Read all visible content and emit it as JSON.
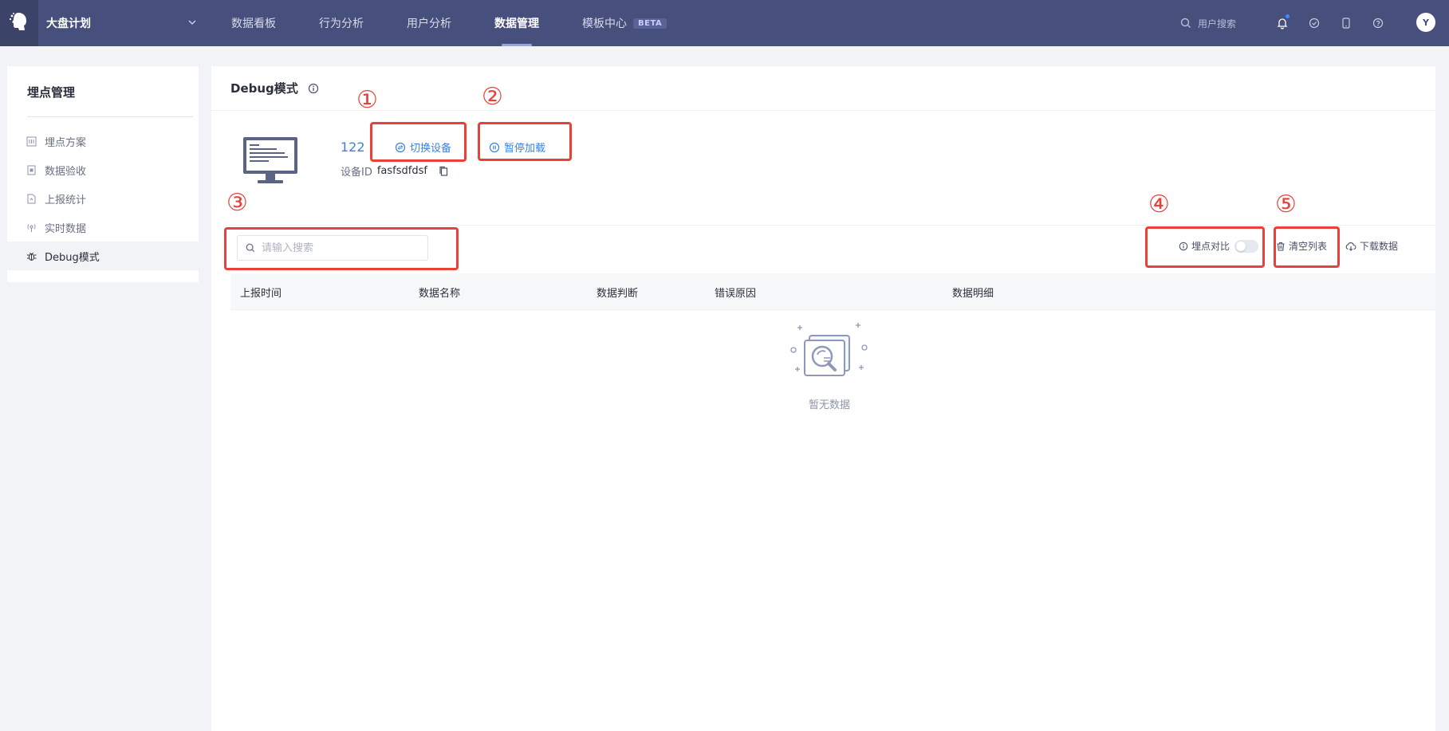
{
  "topbar": {
    "project": "大盘计划",
    "nav": [
      {
        "label": "数据看板"
      },
      {
        "label": "行为分析"
      },
      {
        "label": "用户分析"
      },
      {
        "label": "数据管理"
      },
      {
        "label": "模板中心"
      }
    ],
    "active_nav": "数据管理",
    "beta_badge": "BETA",
    "search_placeholder": "用户搜索",
    "avatar_letter": "Y"
  },
  "sidebar": {
    "title": "埋点管理",
    "items": [
      {
        "label": "埋点方案",
        "icon": "scheme-icon"
      },
      {
        "label": "数据验收",
        "icon": "check-doc-icon"
      },
      {
        "label": "上报统计",
        "icon": "report-icon"
      },
      {
        "label": "实时数据",
        "icon": "broadcast-icon"
      },
      {
        "label": "Debug模式",
        "icon": "bug-icon"
      }
    ],
    "active_item": "Debug模式"
  },
  "main": {
    "title": "Debug模式",
    "device": {
      "number": "122",
      "switch_label": "切换设备",
      "pause_label": "暂停加载",
      "id_label": "设备ID",
      "id_value": "fasfsdfdsf"
    },
    "search_placeholder": "请输入搜索",
    "toolbar": {
      "compare_label": "埋点对比",
      "compare_on": false,
      "clear_label": "清空列表",
      "download_label": "下载数据"
    },
    "table": {
      "columns": [
        "上报时间",
        "数据名称",
        "数据判断",
        "错误原因",
        "数据明细"
      ],
      "rows": []
    },
    "empty_text": "暂无数据"
  },
  "annotations": [
    "①",
    "②",
    "③",
    "④",
    "⑤"
  ],
  "colors": {
    "topbar": "#474f7c",
    "accent": "#3d7fe0",
    "annotation": "#e8413a"
  }
}
